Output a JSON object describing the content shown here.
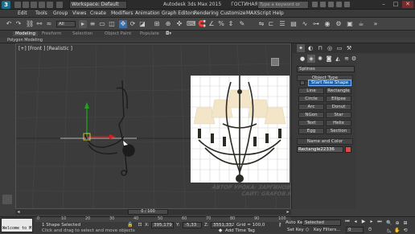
{
  "titlebar": {
    "workspace": "Workspace: Default",
    "app_title": "Autodesk 3ds Max 2015",
    "file_name": "ГОСТИНАЯ13.max",
    "search_placeholder": "Type a keyword or phrase"
  },
  "menus": [
    "Edit",
    "Tools",
    "Group",
    "Views",
    "Create",
    "Modifiers",
    "Animation",
    "Graph Editors",
    "Rendering",
    "Customize",
    "MAXScript",
    "Help"
  ],
  "toolbar": {
    "selection_filter": "All"
  },
  "ribbon": {
    "tabs": [
      "Modeling",
      "Freeform",
      "Selection",
      "Object Paint",
      "Populate"
    ],
    "sub": "Polygon Modeling"
  },
  "viewport": {
    "label": "[+] [Front ] [Realistic ]"
  },
  "watermark": {
    "line1": "АВТОР УРОКА: ЗАРГИНОВА",
    "line2": "САЙТ: GRAFOB.RU"
  },
  "command_panel": {
    "dropdown": "Splines",
    "object_type_title": "Object Type",
    "autogrid": "AutoGrid",
    "start_new_shape": "Start New Shape",
    "buttons": [
      "Line",
      "Rectangle",
      "Circle",
      "Ellipse",
      "Arc",
      "Donut",
      "NGon",
      "Star",
      "Text",
      "Helix",
      "Egg",
      "Section"
    ],
    "name_color_title": "Name and Color",
    "object_name": "Rectangle22336",
    "object_color": "#e04848"
  },
  "timeline": {
    "frame": "0 / 100",
    "ticks": [
      "0",
      "5",
      "10",
      "15",
      "20",
      "25",
      "30",
      "35",
      "40",
      "45",
      "50",
      "55",
      "60",
      "65",
      "70",
      "75",
      "80",
      "85",
      "90",
      "95",
      "100"
    ]
  },
  "status": {
    "listener": "Welcome to M",
    "selection": "1 Shape Selected",
    "hint": "Click and drag to select and move objects",
    "x_label": "X:",
    "x": "395,179",
    "y_label": "Y:",
    "y": "-5,33",
    "z_label": "Z:",
    "z": "3551,332",
    "grid": "Grid = 100,0",
    "add_time_tag": "Add Time Tag",
    "auto_key": "Auto Key",
    "selected": "Selected",
    "set_key": "Set Key",
    "key_filters": "Key Filters...",
    "frame_num": "0"
  }
}
